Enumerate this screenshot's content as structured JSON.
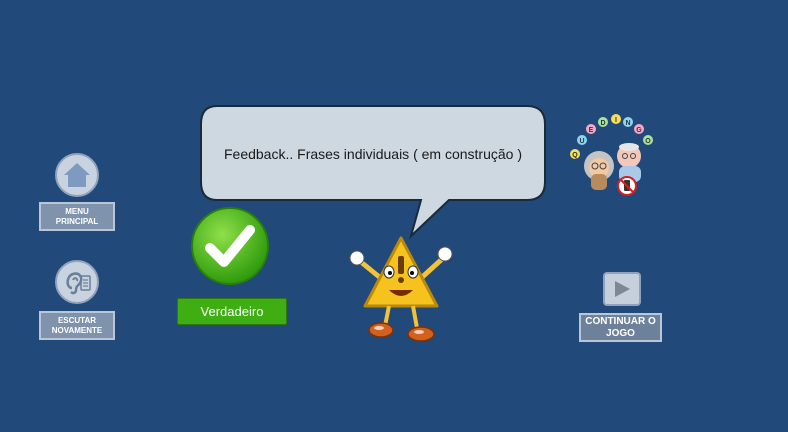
{
  "menu": {
    "label": "MENU PRINCIPAL",
    "icon": "home-icon"
  },
  "listen": {
    "label": "ESCUTAR NOVAMENTE",
    "icon": "hearing-icon"
  },
  "result": {
    "icon": "checkmark-icon",
    "label": "Verdadeiro"
  },
  "feedback": {
    "text": "Feedback.. Frases individuais ( em construção )"
  },
  "mascot": {
    "icon": "warning-mascot-icon"
  },
  "logo": {
    "letters": [
      "Q",
      "U",
      "E",
      "D",
      "I",
      "N",
      "G",
      "O"
    ]
  },
  "continue": {
    "label": "CONTINUAR O JOGO",
    "icon": "play-icon"
  },
  "colors": {
    "background": "#21497a",
    "success": "#3fae12",
    "bubble": "#cdd8e0"
  }
}
